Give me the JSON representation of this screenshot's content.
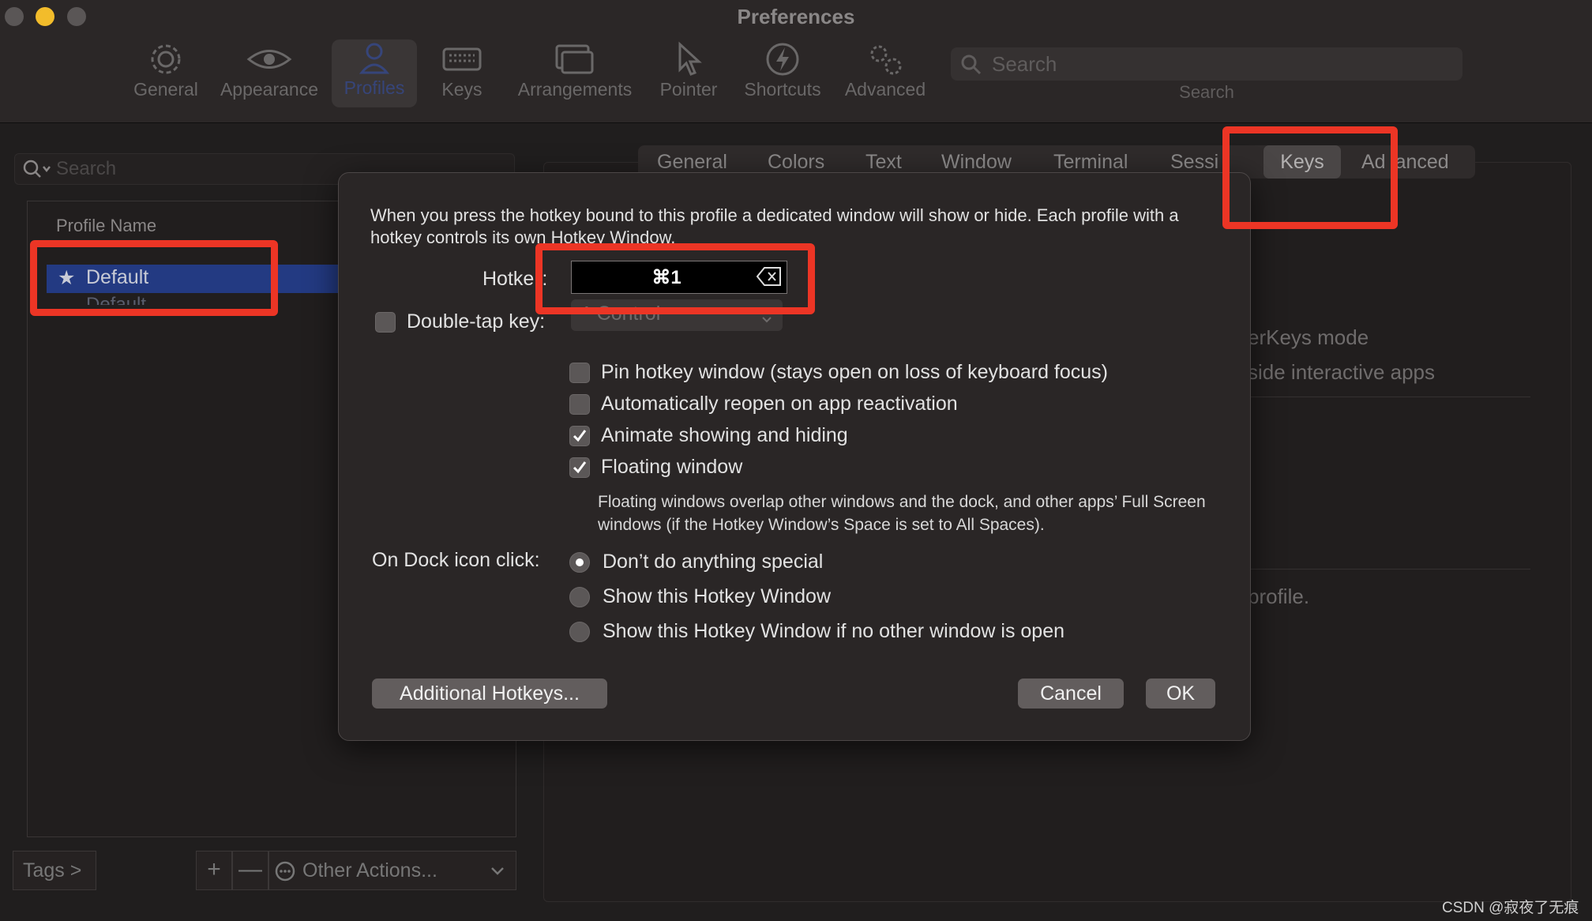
{
  "window": {
    "title": "Preferences"
  },
  "toolbar": {
    "items": [
      {
        "label": "General",
        "icon": "gear-icon"
      },
      {
        "label": "Appearance",
        "icon": "eye-icon"
      },
      {
        "label": "Profiles",
        "icon": "person-icon"
      },
      {
        "label": "Keys",
        "icon": "keyboard-icon"
      },
      {
        "label": "Arrangements",
        "icon": "windows-icon"
      },
      {
        "label": "Pointer",
        "icon": "pointer-icon"
      },
      {
        "label": "Shortcuts",
        "icon": "bolt-icon"
      },
      {
        "label": "Advanced",
        "icon": "gears-icon"
      }
    ],
    "selected": "Profiles",
    "search_placeholder": "Search",
    "search_label": "Search"
  },
  "profiles": {
    "search_placeholder": "Search",
    "column_header": "Profile Name",
    "rows": [
      {
        "name": "Default",
        "default": true
      }
    ],
    "subrow_partial": "Default",
    "tags_label": "Tags >",
    "plus_label": "+",
    "minus_label": "—",
    "other_actions_label": "Other Actions..."
  },
  "profile_tabs": [
    "General",
    "Colors",
    "Text",
    "Window",
    "Terminal",
    "Sessi",
    "Keys",
    "Ad",
    "anced"
  ],
  "selected_tab": "Keys",
  "background_text": {
    "line1": "erKeys mode",
    "line2": "side interactive apps",
    "line3": "profile."
  },
  "dialog": {
    "description": "When you press the hotkey bound to this profile a dedicated window will show or hide. Each profile with a hotkey controls its own Hotkey Window.",
    "hotkey_label_a": "Hotke",
    "hotkey_label_b": ":",
    "hotkey_value": "⌘1",
    "double_tap_label": "Double-tap key:",
    "double_tap_checked": false,
    "double_tap_value": "^ Control",
    "options": [
      {
        "label": "Pin hotkey window (stays open on loss of keyboard focus)",
        "checked": false
      },
      {
        "label": "Automatically reopen on app reactivation",
        "checked": false
      },
      {
        "label": "Animate showing and hiding",
        "checked": true
      },
      {
        "label": "Floating window",
        "checked": true
      }
    ],
    "floating_note": "Floating windows overlap other windows and the dock, and other apps’ Full Screen windows (if the Hotkey Window’s Space is set to All Spaces).",
    "dock_label": "On Dock icon click:",
    "dock_options": [
      {
        "label": "Don’t do anything special",
        "selected": true
      },
      {
        "label": "Show this Hotkey Window",
        "selected": false
      },
      {
        "label": "Show this Hotkey Window if no other window is open",
        "selected": false
      }
    ],
    "additional_hotkeys": "Additional Hotkeys...",
    "cancel": "Cancel",
    "ok": "OK"
  },
  "colors": {
    "annotation_red": "#ec3525",
    "selection_blue": "#233a82"
  },
  "watermark": "CSDN @寂夜了无痕"
}
